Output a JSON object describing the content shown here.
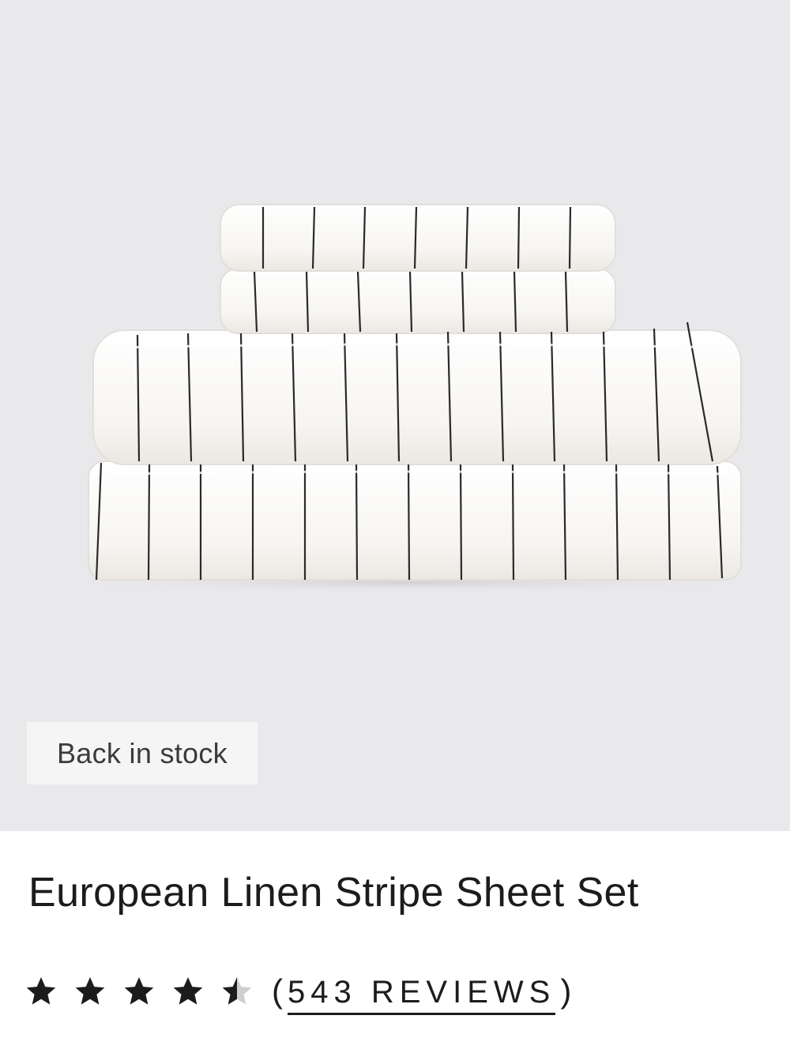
{
  "product": {
    "badge": "Back in stock",
    "title": "European Linen Stripe Sheet Set",
    "rating": {
      "value": 4.5,
      "max": 5,
      "reviews_open": "(",
      "reviews_text": "543 REVIEWS",
      "reviews_close": ")"
    }
  },
  "colors": {
    "image_background": "#e9e9eb",
    "star_fill": "#1c1c1c",
    "star_empty": "#cfcfcf"
  },
  "icons": [
    "star-filled-icon",
    "star-half-icon"
  ]
}
